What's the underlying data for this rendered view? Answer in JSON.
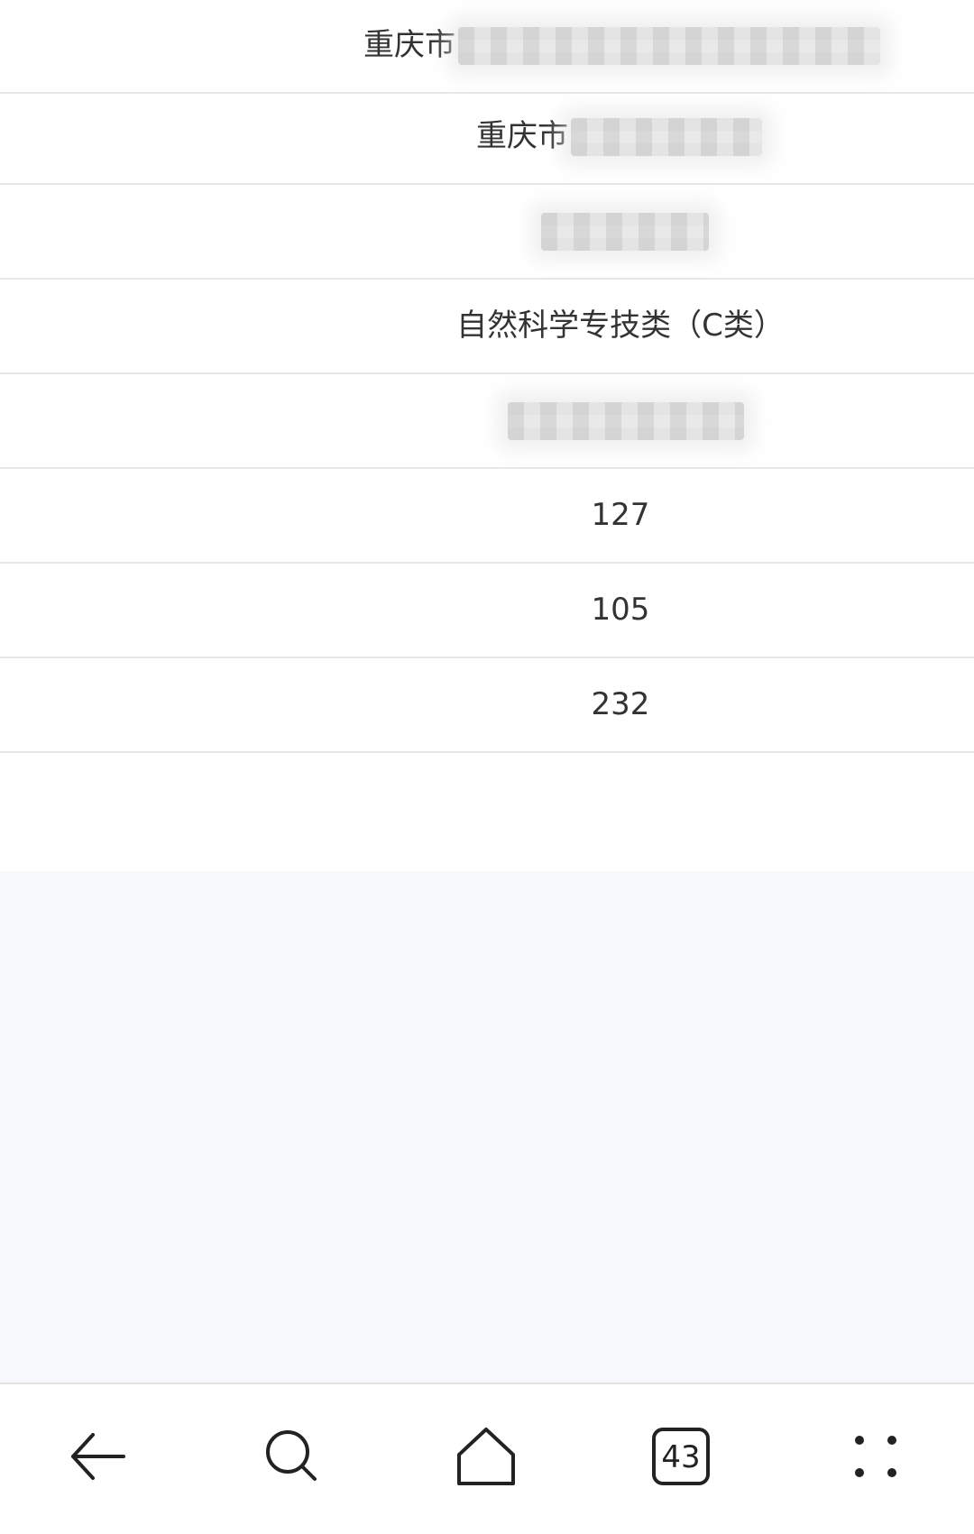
{
  "table": {
    "rows": [
      {
        "text": "重庆市",
        "redacted": true
      },
      {
        "text": "重庆市",
        "redacted": true
      },
      {
        "text": "",
        "redacted": true
      },
      {
        "text": "自然科学专技类（C类）",
        "redacted": false
      },
      {
        "text": "",
        "redacted": true
      },
      {
        "text": "127",
        "redacted": false
      },
      {
        "text": "105",
        "redacted": false
      },
      {
        "text": "232",
        "redacted": false
      }
    ]
  },
  "navbar": {
    "back_icon": "arrow-left-icon",
    "search_icon": "search-icon",
    "home_icon": "home-icon",
    "tabs_icon": "tabs-icon",
    "tabs_count": "43",
    "menu_icon": "four-dots-menu-icon"
  },
  "colors": {
    "text": "#333333",
    "divider": "#e7e7e7",
    "empty_area": "#f8f9fc",
    "icon": "#222222"
  }
}
